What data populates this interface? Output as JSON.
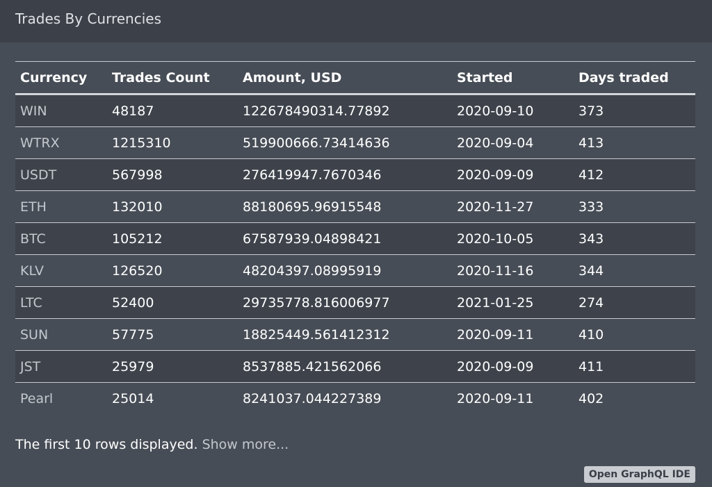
{
  "header": {
    "title": "Trades By Currencies"
  },
  "table": {
    "columns": [
      "Currency",
      "Trades Count",
      "Amount, USD",
      "Started",
      "Days traded"
    ],
    "rows": [
      [
        "WIN",
        "48187",
        "122678490314.77892",
        "2020-09-10",
        "373"
      ],
      [
        "WTRX",
        "1215310",
        "519900666.73414636",
        "2020-09-04",
        "413"
      ],
      [
        "USDT",
        "567998",
        "276419947.7670346",
        "2020-09-09",
        "412"
      ],
      [
        "ETH",
        "132010",
        "88180695.96915548",
        "2020-11-27",
        "333"
      ],
      [
        "BTC",
        "105212",
        "67587939.04898421",
        "2020-10-05",
        "343"
      ],
      [
        "KLV",
        "126520",
        "48204397.08995919",
        "2020-11-16",
        "344"
      ],
      [
        "LTC",
        "52400",
        "29735778.816006977",
        "2021-01-25",
        "274"
      ],
      [
        "SUN",
        "57775",
        "18825449.561412312",
        "2020-09-11",
        "410"
      ],
      [
        "JST",
        "25979",
        "8537885.421562066",
        "2020-09-09",
        "411"
      ],
      [
        "Pearl",
        "25014",
        "8241037.044227389",
        "2020-09-11",
        "402"
      ]
    ]
  },
  "footer": {
    "note": "The first 10 rows displayed.",
    "show_more": "Show more...",
    "ide_button": "Open GraphQL IDE"
  }
}
